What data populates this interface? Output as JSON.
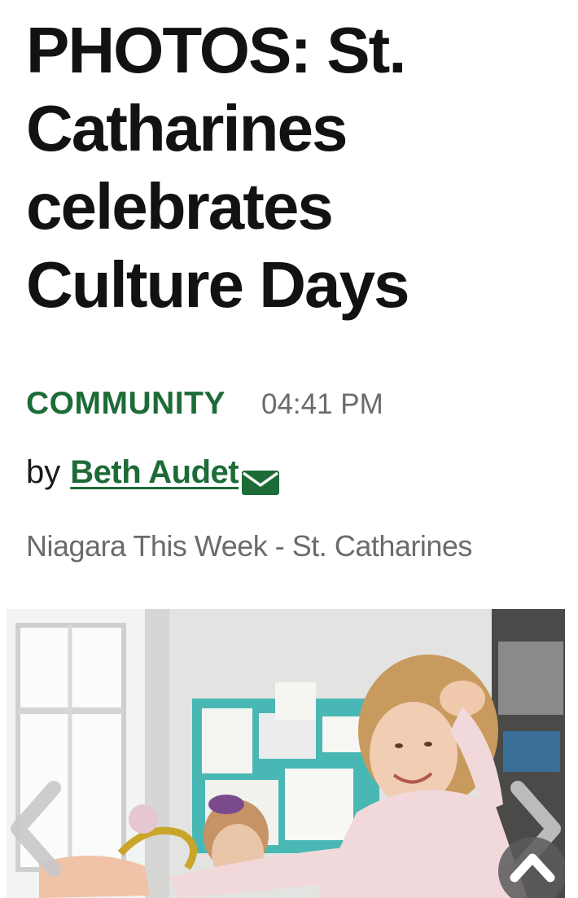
{
  "article": {
    "headline": "PHOTOS: St. Catharines celebrates Culture Days",
    "category": "COMMUNITY",
    "time": "04:41 PM",
    "byline_prefix": "by",
    "author": "Beth Audet",
    "publication": "Niagara This Week - St. Catharines"
  },
  "colors": {
    "accent": "#1d6b37",
    "meta_gray": "#6b6b6b",
    "headline": "#121212"
  },
  "icons": {
    "author_email": "envelope-icon",
    "gallery_prev": "chevron-left-icon",
    "gallery_next": "chevron-right-icon",
    "scroll_top": "chevron-up-icon"
  },
  "gallery": {
    "image": "photo-gallery-image"
  }
}
